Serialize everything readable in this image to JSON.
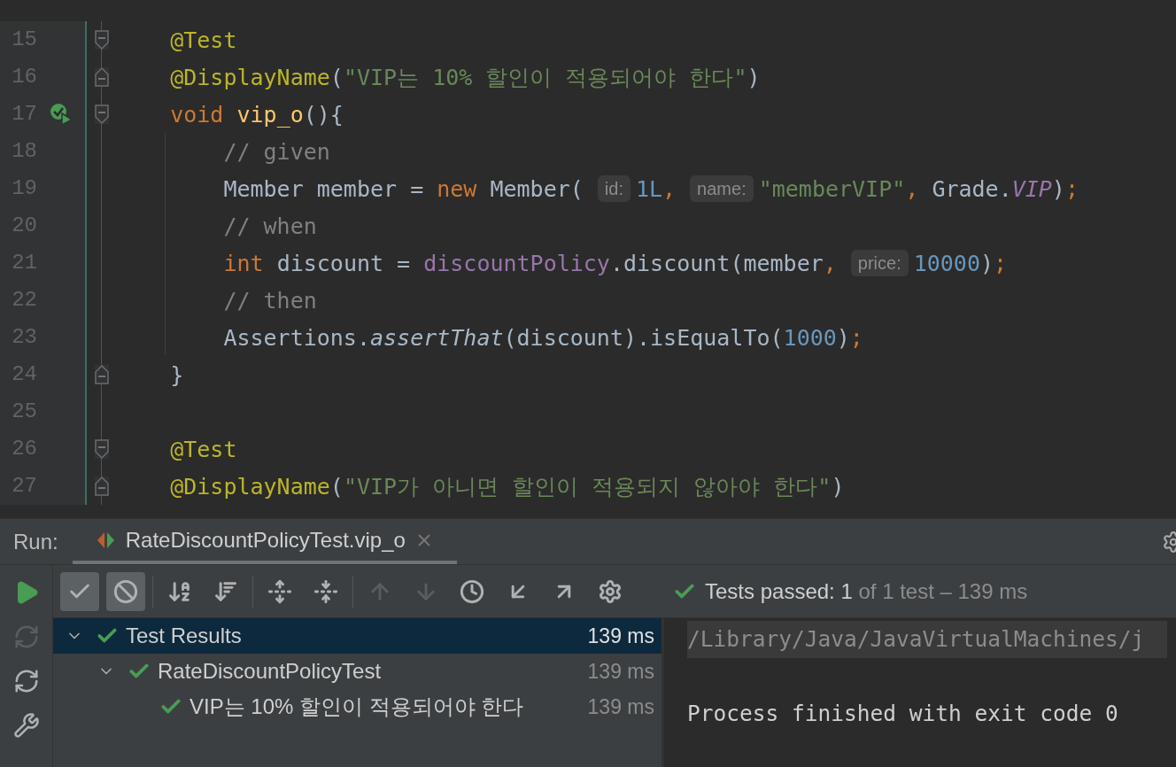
{
  "editor": {
    "lines": [
      {
        "number": "15",
        "fold_start": true,
        "fold_end": false,
        "test_passed": false,
        "tokens": [
          {
            "kind": "annotation",
            "text": "    @Test"
          }
        ]
      },
      {
        "number": "16",
        "fold_start": false,
        "fold_end": true,
        "test_passed": false,
        "tokens": [
          {
            "kind": "annotation",
            "text": "    @DisplayName"
          },
          {
            "kind": "plain",
            "text": "("
          },
          {
            "kind": "string",
            "text": "\"VIP는 10% 할인이 적용되어야 한다\""
          },
          {
            "kind": "plain",
            "text": ")"
          }
        ]
      },
      {
        "number": "17",
        "fold_start": true,
        "fold_end": false,
        "test_passed": true,
        "tokens": [
          {
            "kind": "keyword",
            "text": "    void"
          },
          {
            "kind": "function",
            "text": " vip_o"
          },
          {
            "kind": "plain",
            "text": "(){"
          }
        ]
      },
      {
        "number": "18",
        "fold_start": false,
        "fold_end": false,
        "test_passed": false,
        "tokens": [
          {
            "kind": "comment",
            "text": "        // given"
          }
        ]
      },
      {
        "number": "19",
        "fold_start": false,
        "fold_end": false,
        "test_passed": false,
        "tokens": [
          {
            "kind": "plain",
            "text": "        Member member = "
          },
          {
            "kind": "keyword",
            "text": "new"
          },
          {
            "kind": "plain",
            "text": " Member("
          },
          {
            "kind": "hint",
            "text": "id:"
          },
          {
            "kind": "number",
            "text": "1L"
          },
          {
            "kind": "punct",
            "text": ","
          },
          {
            "kind": "hint",
            "text": "name:"
          },
          {
            "kind": "string",
            "text": "\"memberVIP\""
          },
          {
            "kind": "punct",
            "text": ","
          },
          {
            "kind": "plain",
            "text": " Grade."
          },
          {
            "kind": "constant",
            "text": "VIP"
          },
          {
            "kind": "plain",
            "text": ")"
          },
          {
            "kind": "punct",
            "text": ";"
          }
        ]
      },
      {
        "number": "20",
        "fold_start": false,
        "fold_end": false,
        "test_passed": false,
        "tokens": [
          {
            "kind": "comment",
            "text": "        // when"
          }
        ]
      },
      {
        "number": "21",
        "fold_start": false,
        "fold_end": false,
        "test_passed": false,
        "tokens": [
          {
            "kind": "keyword",
            "text": "        int"
          },
          {
            "kind": "plain",
            "text": " discount = "
          },
          {
            "kind": "field",
            "text": "discountPolicy"
          },
          {
            "kind": "plain",
            "text": ".discount(member"
          },
          {
            "kind": "punct",
            "text": ","
          },
          {
            "kind": "hint",
            "text": "price:"
          },
          {
            "kind": "number",
            "text": "10000"
          },
          {
            "kind": "plain",
            "text": ")"
          },
          {
            "kind": "punct",
            "text": ";"
          }
        ]
      },
      {
        "number": "22",
        "fold_start": false,
        "fold_end": false,
        "test_passed": false,
        "tokens": [
          {
            "kind": "comment",
            "text": "        // then"
          }
        ]
      },
      {
        "number": "23",
        "fold_start": false,
        "fold_end": false,
        "test_passed": false,
        "tokens": [
          {
            "kind": "plain",
            "text": "        Assertions."
          },
          {
            "kind": "static_method",
            "text": "assertThat"
          },
          {
            "kind": "plain",
            "text": "(discount).isEqualTo("
          },
          {
            "kind": "number",
            "text": "1000"
          },
          {
            "kind": "plain",
            "text": ")"
          },
          {
            "kind": "punct",
            "text": ";"
          }
        ]
      },
      {
        "number": "24",
        "fold_start": false,
        "fold_end": true,
        "test_passed": false,
        "tokens": [
          {
            "kind": "plain",
            "text": "    }"
          }
        ]
      },
      {
        "number": "25",
        "fold_start": false,
        "fold_end": false,
        "test_passed": false
      },
      {
        "number": "26",
        "fold_start": true,
        "fold_end": false,
        "test_passed": false,
        "tokens": [
          {
            "kind": "annotation",
            "text": "    @Test"
          }
        ]
      },
      {
        "number": "27",
        "fold_start": false,
        "fold_end": true,
        "test_passed": false,
        "tokens": [
          {
            "kind": "annotation",
            "text": "    @DisplayName"
          },
          {
            "kind": "plain",
            "text": "("
          },
          {
            "kind": "string",
            "text": "\"VIP가 아니면 할인이 적용되지 않아야 한다\""
          },
          {
            "kind": "plain",
            "text": ")"
          }
        ]
      }
    ]
  },
  "run_panel": {
    "label": "Run:",
    "tab": {
      "title": "RateDiscountPolicyTest.vip_o",
      "selected": true
    },
    "side_tools": [
      {
        "kind": "run",
        "disabled": false
      },
      {
        "kind": "rerun_failed",
        "disabled": true
      },
      {
        "kind": "toggle_auto",
        "disabled": false
      },
      {
        "kind": "settings",
        "disabled": false
      }
    ],
    "toolbar": [
      {
        "kind": "show_passed",
        "on": true,
        "disabled": false
      },
      {
        "kind": "show_ignored",
        "on": true,
        "disabled": false
      },
      {
        "kind": "sort_alpha",
        "on": false,
        "disabled": false
      },
      {
        "kind": "sort_duration",
        "on": false,
        "disabled": false
      },
      {
        "kind": "expand_all",
        "on": false,
        "disabled": false
      },
      {
        "kind": "collapse_all",
        "on": false,
        "disabled": false
      },
      {
        "kind": "previous",
        "on": false,
        "disabled": true
      },
      {
        "kind": "next",
        "on": false,
        "disabled": true
      },
      {
        "kind": "history",
        "on": false,
        "disabled": false
      },
      {
        "kind": "import",
        "on": false,
        "disabled": false
      },
      {
        "kind": "export",
        "on": false,
        "disabled": false
      },
      {
        "kind": "options",
        "on": false,
        "disabled": false
      }
    ],
    "status": {
      "label": "Tests passed:",
      "passed": "1",
      "detail": "of 1 test – 139 ms"
    },
    "tree": [
      {
        "label": "Test Results",
        "time": "139 ms",
        "passed": true,
        "expanded": true,
        "selected": true,
        "children": [
          {
            "label": "RateDiscountPolicyTest",
            "time": "139 ms",
            "passed": true,
            "expanded": true,
            "selected": false,
            "children": [
              {
                "label": "VIP는 10% 할인이 적용되어야 한다",
                "time": "139 ms",
                "passed": true,
                "selected": false
              }
            ]
          }
        ]
      }
    ],
    "console": [
      {
        "text": "/Library/Java/JavaVirtualMachines/j",
        "highlighted": true
      },
      {
        "text": "Process finished with exit code 0",
        "highlighted": false
      }
    ]
  }
}
